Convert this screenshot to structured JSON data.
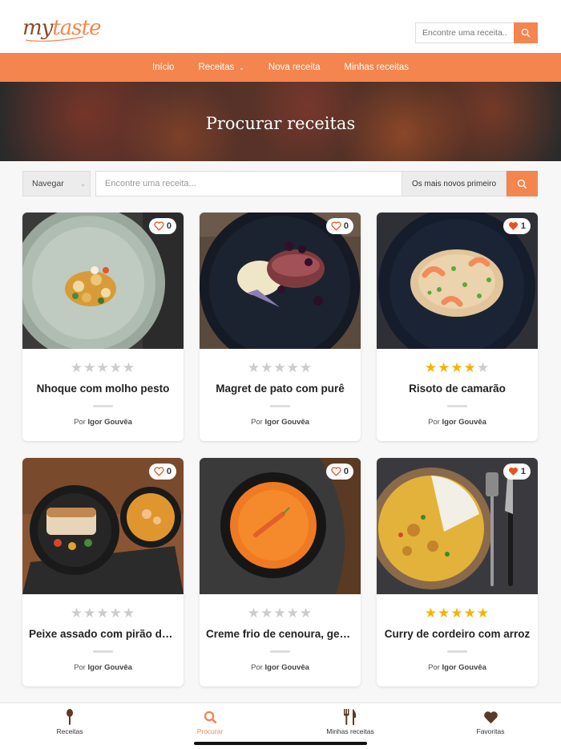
{
  "app": {
    "logo_my": "my",
    "logo_taste": "taste"
  },
  "header_search": {
    "placeholder": "Encontre uma receita..."
  },
  "nav": {
    "items": [
      {
        "label": "Início"
      },
      {
        "label": "Receitas",
        "has_dropdown": true
      },
      {
        "label": "Nova receita"
      },
      {
        "label": "Minhas receitas"
      }
    ]
  },
  "banner": {
    "title": "Procurar receitas"
  },
  "filter": {
    "browse_label": "Navegar",
    "search_placeholder": "Encontre uma receita...",
    "sort_label": "Os mais novos primeiro"
  },
  "colors": {
    "accent": "#f4854e",
    "star_on": "#f5b400",
    "star_off": "#cccccc",
    "heart_active": "#e8531f"
  },
  "author_prefix": "Por",
  "recipes": [
    {
      "title": "Nhoque com molho pesto",
      "author": "Igor Gouvêa",
      "favorites": "0",
      "favorited": false,
      "rating": 0,
      "photo": "gnocchi-pesto-plate"
    },
    {
      "title": "Magret de pato com purê",
      "author": "Igor Gouvêa",
      "favorites": "0",
      "favorited": false,
      "rating": 0,
      "photo": "duck-puree-plate"
    },
    {
      "title": "Risoto de camarão",
      "author": "Igor Gouvêa",
      "favorites": "1",
      "favorited": true,
      "rating": 4,
      "photo": "shrimp-risotto-plate"
    },
    {
      "title": "Peixe assado com pirão de camarão",
      "author": "Igor Gouvêa",
      "favorites": "0",
      "favorited": false,
      "rating": 0,
      "photo": "roasted-fish-bowls"
    },
    {
      "title": "Creme frio de cenoura, gengibre e laranja",
      "author": "Igor Gouvêa",
      "favorites": "0",
      "favorited": false,
      "rating": 0,
      "photo": "carrot-soup-bowl"
    },
    {
      "title": "Curry de cordeiro com arroz",
      "author": "Igor Gouvêa",
      "favorites": "1",
      "favorited": true,
      "rating": 5,
      "photo": "lamb-curry-rice"
    }
  ],
  "tabbar": {
    "items": [
      {
        "label": "Receitas",
        "icon": "spoon-icon"
      },
      {
        "label": "Procurar",
        "icon": "search-icon",
        "active": true
      },
      {
        "label": "Minhas receitas",
        "icon": "fork-knife-icon"
      },
      {
        "label": "Favoritas",
        "icon": "heart-icon"
      }
    ]
  }
}
